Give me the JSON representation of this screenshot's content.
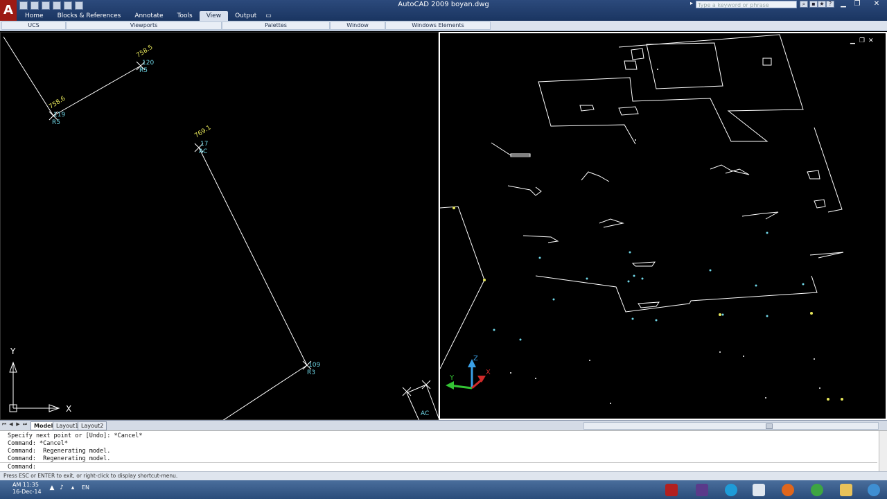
{
  "app": {
    "window_title": "AutoCAD 2009 boyan.dwg",
    "logo_glyph": "A",
    "search_placeholder": "Type a keyword or phrase"
  },
  "ribbon": {
    "tabs": [
      {
        "label": "Home",
        "active": false
      },
      {
        "label": "Blocks & References",
        "active": false
      },
      {
        "label": "Annotate",
        "active": false
      },
      {
        "label": "Tools",
        "active": false
      },
      {
        "label": "View",
        "active": true
      },
      {
        "label": "Output",
        "active": false
      }
    ],
    "panels": [
      "UCS",
      "Viewports",
      "Palettes",
      "Window",
      "Windows Elements"
    ]
  },
  "viewport_left": {
    "points": [
      {
        "elev": "758.5",
        "id": "120",
        "code": "R5"
      },
      {
        "elev": "758.6",
        "id": "119",
        "code": "R5"
      },
      {
        "elev": "769.1",
        "id": "17",
        "code": "AC"
      },
      {
        "id": "109",
        "code": "R3"
      },
      {
        "code": "AC"
      }
    ],
    "ucs_x": "X",
    "ucs_y": "Y"
  },
  "viewport_right": {
    "controls": [
      "▁",
      "❐",
      "✕"
    ],
    "gizmo_z": "Z",
    "gizmo_y": "Y",
    "gizmo_x": "X"
  },
  "layout_tabs": [
    {
      "label": "Model",
      "active": true
    },
    {
      "label": "Layout1",
      "active": false
    },
    {
      "label": "Layout2",
      "active": false
    }
  ],
  "command_window": {
    "history": [
      "Specify next point or [Undo]: *Cancel*",
      "Command: *Cancel*",
      "Command:  Regenerating model.",
      "Command:  Regenerating model."
    ],
    "prompt": "Command:"
  },
  "status_bar": {
    "message": "Press ESC or ENTER to exit, or right-click to display shortcut-menu."
  },
  "taskbar": {
    "time": "AM 11:35",
    "date": "16-Dec-14",
    "language": "EN"
  },
  "colors": {
    "canvas": "#000000",
    "linework": "#ffffff",
    "label_yellow": "#e6e65a",
    "label_cyan": "#6fd6e6"
  }
}
